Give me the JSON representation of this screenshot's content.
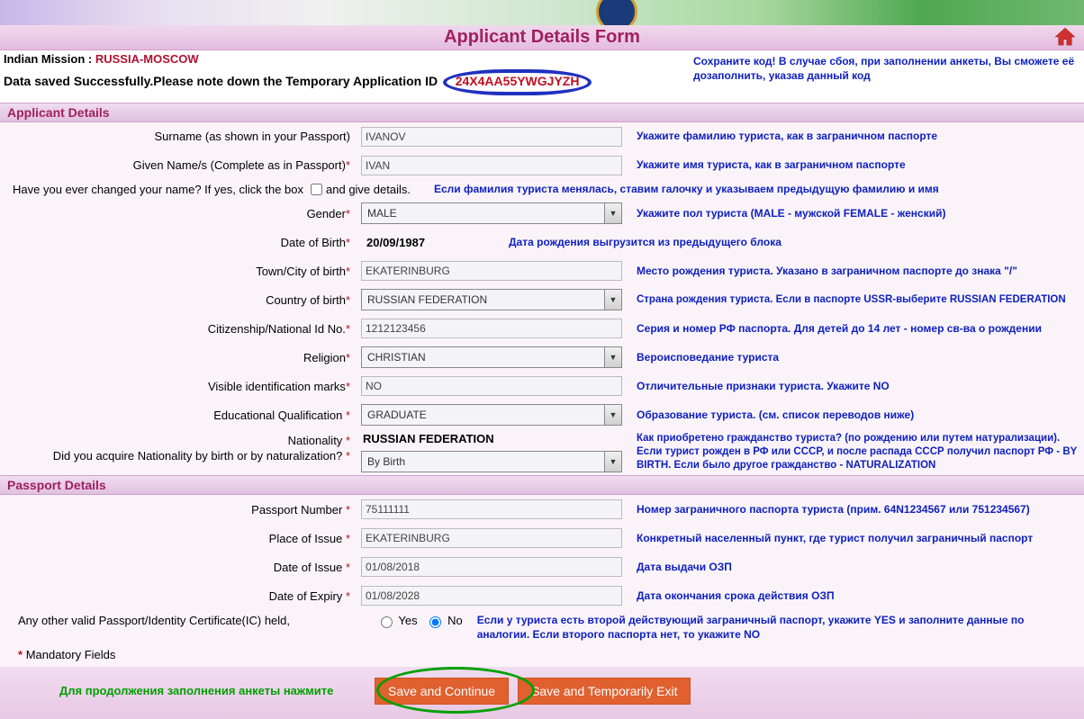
{
  "page_title": "Applicant Details Form",
  "mission_label": "Indian Mission :",
  "mission_value": "RUSSIA-MOSCOW",
  "saved_msg": "Data saved Successfully.Please note down the Temporary Application ID",
  "app_id": "24X4AA55YWGJYZH",
  "save_hint": "Сохраните код! В случае сбоя, при заполнении анкеты, Вы сможете её дозаполнить, указав данный код",
  "sections": {
    "applicant": "Applicant Details",
    "passport": "Passport Details"
  },
  "labels": {
    "surname": "Surname (as shown in your Passport)",
    "given": "Given Name/s (Complete as in Passport)",
    "changed_q": "Have you ever changed your name? If yes, click the box",
    "changed_give": "and give details.",
    "gender": "Gender",
    "dob": "Date of Birth",
    "town": "Town/City of birth",
    "cob": "Country of birth",
    "nid": "Citizenship/National Id No.",
    "religion": "Religion",
    "marks": "Visible identification marks",
    "edu": "Educational Qualification",
    "nat": "Nationality",
    "nat_q": "Did you acquire Nationality by birth or by naturalization?",
    "pp_no": "Passport Number",
    "pp_place": "Place of Issue",
    "pp_issue": "Date of Issue",
    "pp_expiry": "Date of Expiry",
    "other_pp_q": "Any other valid Passport/Identity Certificate(IC) held,",
    "yes": "Yes",
    "no": "No",
    "mandatory": "Mandatory Fields"
  },
  "values": {
    "surname": "IVANOV",
    "given": "IVAN",
    "gender": "MALE",
    "dob": "20/09/1987",
    "town": "EKATERINBURG",
    "cob": "RUSSIAN FEDERATION",
    "nid": "1212123456",
    "religion": "CHRISTIAN",
    "marks": "NO",
    "edu": "GRADUATE",
    "nat": "RUSSIAN FEDERATION",
    "nat_acq": "By Birth",
    "pp_no": "75111111",
    "pp_place": "EKATERINBURG",
    "pp_issue": "01/08/2018",
    "pp_expiry": "01/08/2028"
  },
  "hints": {
    "surname": "Укажите фамилию туриста, как в заграничном паспорте",
    "given": "Укажите имя туриста, как в заграничном паспорте",
    "changed": "Если фамилия туриста менялась, ставим галочку и указываем предыдущую фамилию и имя",
    "gender": "Укажите пол туриста (MALE - мужской FEMALE - женский)",
    "dob": "Дата рождения выгрузится из предыдущего блока",
    "town": "Место рождения туриста. Указано в заграничном паспорте до знака \"/\"",
    "cob": "Страна рождения туриста. Если в паспорте USSR-выберите RUSSIAN FEDERATION",
    "nid": "Серия и номер РФ паспорта. Для детей до 14 лет - номер св-ва о рождении",
    "religion": "Вероисповедание туриста",
    "marks": "Отличительные признаки туриста. Укажите NO",
    "edu": "Образование туриста. (см. список переводов ниже)",
    "nat_q": "Как приобретено гражданство туриста? (по рождению или путем натурализации). Если турист рожден в РФ или СССР, и после распада СССР получил паспорт РФ - BY BIRTH. Если было другое гражданство - NATURALIZATION",
    "pp_no": "Номер заграничного паспорта туриста (прим. 64N1234567 или 751234567)",
    "pp_place": "Конкретный населенный пункт, где турист получил заграничный паспорт",
    "pp_issue": "Дата выдачи ОЗП",
    "pp_expiry": "Дата окончания срока действия ОЗП",
    "other_pp": "Если у туриста есть второй действующий заграничный паспорт, укажите YES и заполните данные по аналогии. Если второго паспорта нет, то укажите NO"
  },
  "buttons": {
    "pretext": "Для продолжения заполнения анкеты нажмите",
    "save_continue": "Save and Continue",
    "save_exit": "Save and Temporarily Exit"
  }
}
